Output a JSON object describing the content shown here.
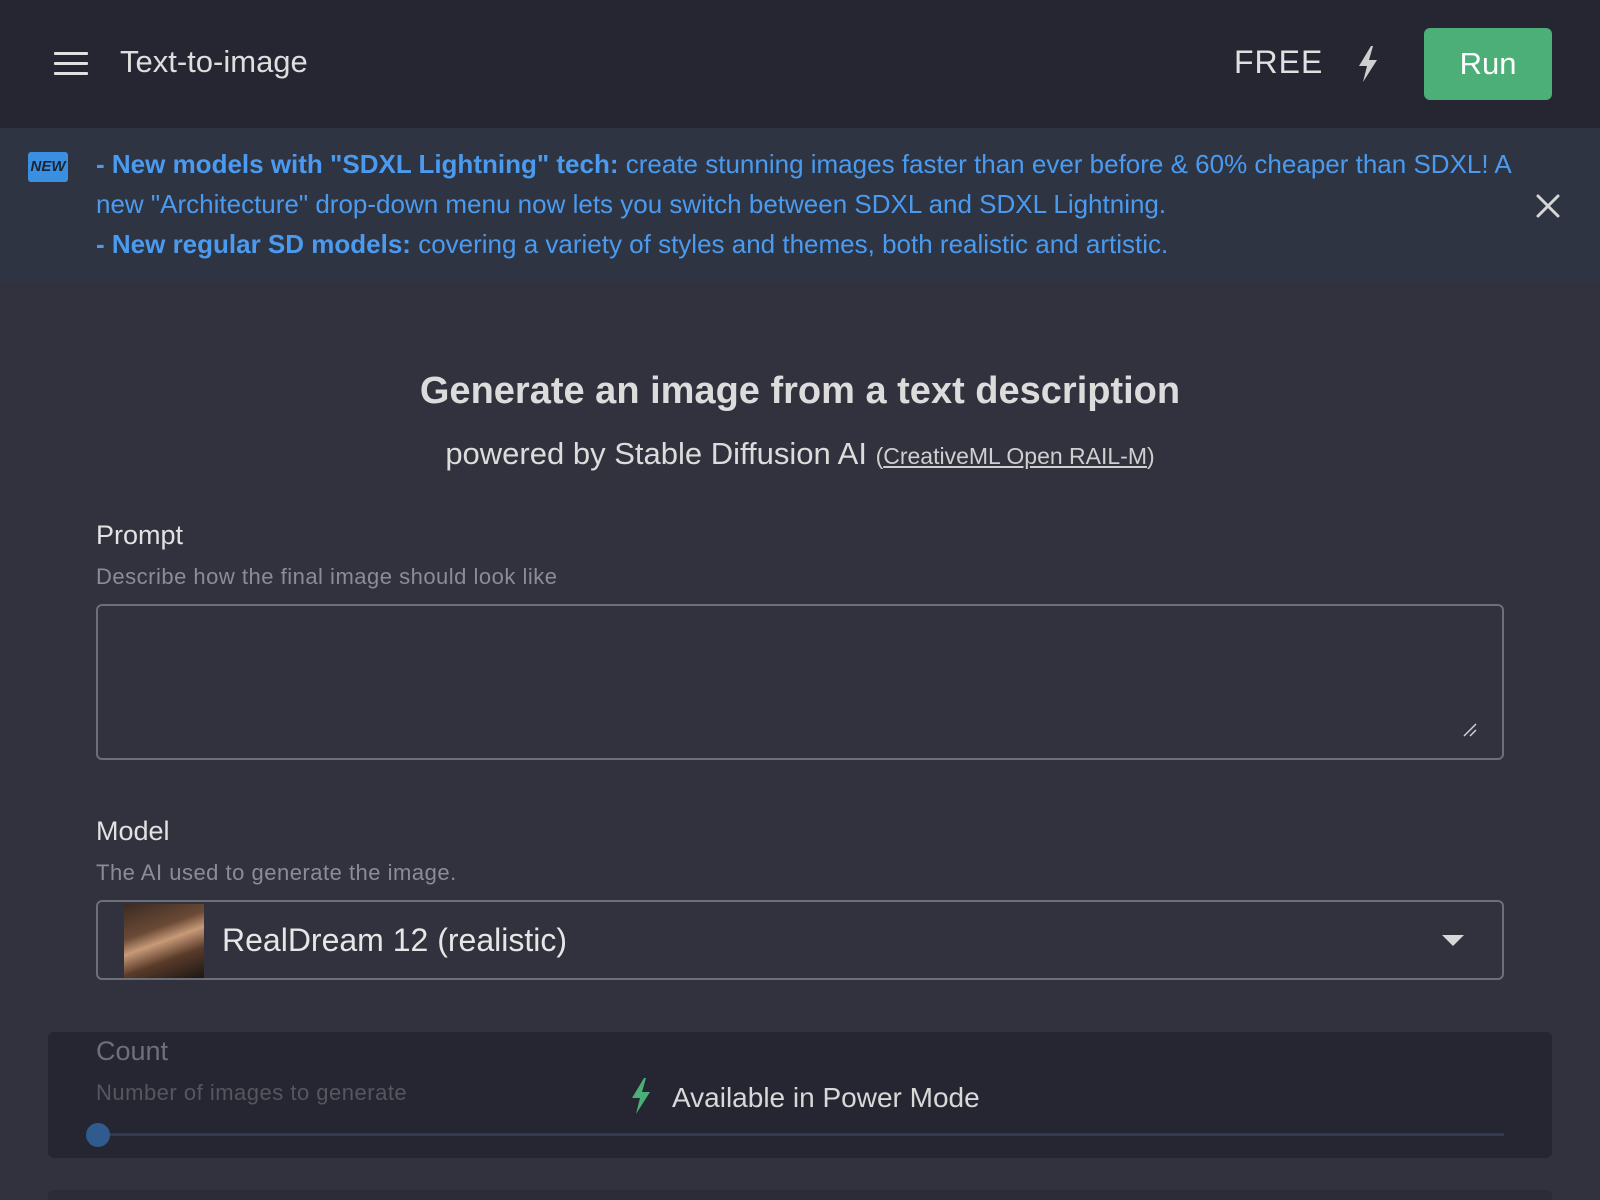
{
  "header": {
    "title": "Text-to-image",
    "plan_label": "FREE",
    "run_label": "Run",
    "menu_icon": "hamburger-menu-icon",
    "bolt_icon": "lightning-bolt-icon"
  },
  "banner": {
    "badge": "NEW",
    "line1_bold": "- New models with \"SDXL Lightning\" tech:",
    "line1_text": " create stunning images faster than ever before & 60% cheaper than SDXL! A new \"Architecture\" drop-down menu now lets you switch between SDXL and SDXL Lightning.",
    "line2_bold": "- New regular SD models:",
    "line2_text": " covering a variety of styles and themes, both realistic and artistic.",
    "close_icon": "close-icon",
    "text_color": "#4a9bf0"
  },
  "hero": {
    "title": "Generate an image from a text description",
    "subtitle": "powered by Stable Diffusion AI",
    "license_open": "(",
    "license_link": "CreativeML Open RAIL-M",
    "license_close": ")"
  },
  "prompt": {
    "label": "Prompt",
    "help": "Describe how the final image should look like",
    "value": "",
    "placeholder": ""
  },
  "model": {
    "label": "Model",
    "help": "The AI used to generate the image.",
    "selected": "RealDream 12 (realistic)",
    "caret_icon": "chevron-down-icon"
  },
  "count": {
    "label": "Count",
    "help": "Number of images to generate",
    "power_note": "Available in Power Mode",
    "slider_value": 0
  },
  "colors": {
    "run_button": "#4caf78",
    "accent_blue": "#4a9bf0",
    "power_bolt": "#4caf78",
    "background": "#31323d",
    "topbar": "#252631"
  }
}
